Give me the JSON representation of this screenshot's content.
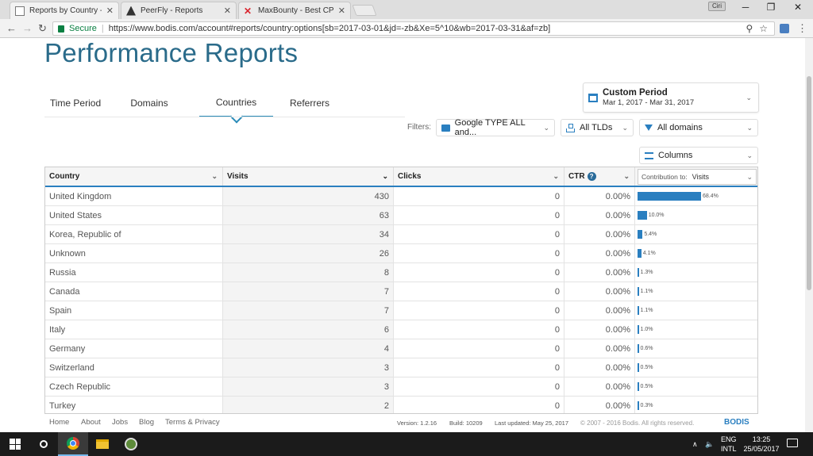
{
  "browser": {
    "tabs": [
      {
        "label": "Reports by Country - Bod",
        "favicon": "document-icon"
      },
      {
        "label": "PeerFly - Reports",
        "favicon": "peerfly-icon"
      },
      {
        "label": "MaxBounty - Best CPA ne",
        "favicon": "maxbounty-icon"
      }
    ],
    "profile_label": "Ciri",
    "secure_label": "Secure",
    "url": "https://www.bodis.com/account#reports/country:options[sb=2017-03-01&jd=-zb&Xe=5^10&wb=2017-03-31&af=zb]"
  },
  "page": {
    "title": "Performance Reports",
    "tabs": [
      {
        "label": "Time Period",
        "active": false
      },
      {
        "label": "Domains",
        "active": false
      },
      {
        "label": "Countries",
        "active": true
      },
      {
        "label": "Referrers",
        "active": false
      }
    ],
    "period": {
      "title": "Custom Period",
      "range": "Mar 1, 2017 - Mar 31, 2017"
    },
    "filters": {
      "label": "Filters:",
      "campaign": "Google TYPE ALL and...",
      "tlds": "All TLDs",
      "domains": "All domains",
      "columns": "Columns"
    }
  },
  "table": {
    "headers": {
      "country": "Country",
      "visits": "Visits",
      "clicks": "Clicks",
      "ctr": "CTR",
      "contribution_label": "Contribution to:",
      "contribution_value": "Visits"
    },
    "rows": [
      {
        "country": "United Kingdom",
        "visits": "430",
        "clicks": "0",
        "ctr": "0.00%",
        "share": 68.4,
        "pct": "68.4%"
      },
      {
        "country": "United States",
        "visits": "63",
        "clicks": "0",
        "ctr": "0.00%",
        "share": 10.0,
        "pct": "10.0%"
      },
      {
        "country": "Korea, Republic of",
        "visits": "34",
        "clicks": "0",
        "ctr": "0.00%",
        "share": 5.4,
        "pct": "5.4%"
      },
      {
        "country": "Unknown",
        "visits": "26",
        "clicks": "0",
        "ctr": "0.00%",
        "share": 4.1,
        "pct": "4.1%"
      },
      {
        "country": "Russia",
        "visits": "8",
        "clicks": "0",
        "ctr": "0.00%",
        "share": 1.3,
        "pct": "1.3%"
      },
      {
        "country": "Canada",
        "visits": "7",
        "clicks": "0",
        "ctr": "0.00%",
        "share": 1.1,
        "pct": "1.1%"
      },
      {
        "country": "Spain",
        "visits": "7",
        "clicks": "0",
        "ctr": "0.00%",
        "share": 1.1,
        "pct": "1.1%"
      },
      {
        "country": "Italy",
        "visits": "6",
        "clicks": "0",
        "ctr": "0.00%",
        "share": 1.0,
        "pct": "1.0%"
      },
      {
        "country": "Germany",
        "visits": "4",
        "clicks": "0",
        "ctr": "0.00%",
        "share": 0.6,
        "pct": "0.6%"
      },
      {
        "country": "Switzerland",
        "visits": "3",
        "clicks": "0",
        "ctr": "0.00%",
        "share": 0.5,
        "pct": "0.5%"
      },
      {
        "country": "Czech Republic",
        "visits": "3",
        "clicks": "0",
        "ctr": "0.00%",
        "share": 0.5,
        "pct": "0.5%"
      },
      {
        "country": "Turkey",
        "visits": "2",
        "clicks": "0",
        "ctr": "0.00%",
        "share": 0.3,
        "pct": "0.3%"
      }
    ]
  },
  "footer": {
    "links": [
      "Home",
      "About",
      "Jobs",
      "Blog",
      "Terms & Privacy"
    ],
    "version": "Version: 1.2.16",
    "build": "Build: 10209",
    "updated": "Last updated: May 25, 2017",
    "copyright": "© 2007 - 2016 Bodis. All rights reserved.",
    "brand": "BODIS"
  },
  "taskbar": {
    "lang": "ENG",
    "layout": "INTL",
    "time": "13:25",
    "date": "25/05/2017"
  },
  "colors": {
    "accent": "#2a7fc0",
    "title": "#2a6b8a"
  }
}
